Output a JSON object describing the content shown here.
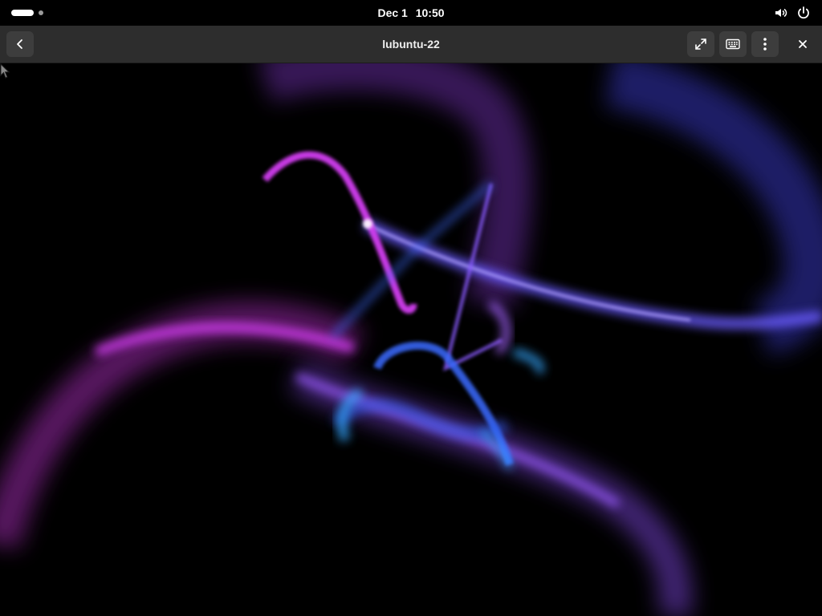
{
  "topbar": {
    "date": "Dec 1",
    "time": "10:50",
    "icons": [
      "activities-indicator",
      "volume-icon",
      "power-icon"
    ]
  },
  "headerbar": {
    "title": "lubuntu-22",
    "buttons": [
      "back-icon",
      "fullscreen-icon",
      "keyboard-icon",
      "menu-kebab-icon",
      "close-icon"
    ]
  },
  "viewport": {
    "content": "remote screensaver",
    "colors": {
      "magenta": "#d23cf0",
      "violet": "#8a4dff",
      "blue": "#3a6bff",
      "cyan": "#34a8ff"
    }
  }
}
